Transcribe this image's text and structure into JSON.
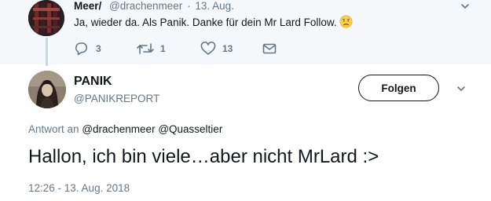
{
  "parent_tweet": {
    "display_name": "Meer/",
    "handle": "@drachenmeer",
    "separator": "·",
    "date": "13. Aug.",
    "text": "Ja, wieder da. Als Panik. Danke für dein Mr Lard Follow.",
    "emoji": "worried-face-emoji",
    "actions": {
      "replies": "3",
      "retweets": "1",
      "likes": "13"
    }
  },
  "main_tweet": {
    "display_name": "PANIK",
    "handle": "@PANIKREPORT",
    "follow_label": "Folgen",
    "reply_prefix": "Antwort an",
    "mention_1": "@drachenmeer",
    "mention_2": "@Quasseltier",
    "text": "Hallon, ich bin viele…aber nicht MrLard :>",
    "timestamp": "12:26 - 13. Aug. 2018"
  },
  "icons": [
    "reply-icon",
    "retweet-icon",
    "like-icon",
    "message-icon",
    "chevron-down-icon"
  ],
  "colors": {
    "parent_bg": "#f5f8fa",
    "secondary_text": "#657786",
    "primary_text": "#14171a",
    "thread_line": "#ccd6dd"
  }
}
